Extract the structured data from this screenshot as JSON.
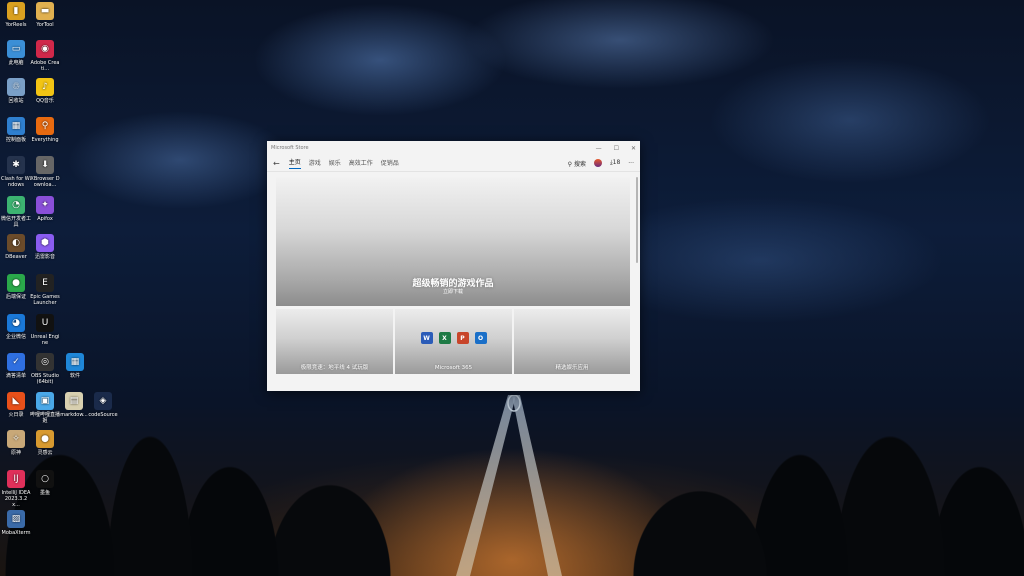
{
  "desktop": {
    "icons": [
      {
        "label": "YorReels",
        "color": "#d9a020",
        "glyph": "▮"
      },
      {
        "label": "YorTool",
        "color": "#e0b050",
        "glyph": "▬"
      },
      {
        "label": "此电脑",
        "color": "#3b8fd6",
        "glyph": "▭"
      },
      {
        "label": "Adobe Creati...",
        "color": "#d0284a",
        "glyph": "◉"
      },
      {
        "label": "回收站",
        "color": "#7aa0c8",
        "glyph": "♲"
      },
      {
        "label": "QQ音乐",
        "color": "#f2c414",
        "glyph": "♪"
      },
      {
        "label": "控制面板",
        "color": "#2f7fcf",
        "glyph": "▦"
      },
      {
        "label": "Everything",
        "color": "#e86a10",
        "glyph": "⚲"
      },
      {
        "label": "Clash for Windows",
        "color": "#25334d",
        "glyph": "✱"
      },
      {
        "label": "XBrowser Downloa...",
        "color": "#666666",
        "glyph": "⬇"
      },
      {
        "label": "微信开发者工具",
        "color": "#3cb371",
        "glyph": "◔"
      },
      {
        "label": "Apifox",
        "color": "#8a4fd8",
        "glyph": "✦"
      },
      {
        "label": "DBeaver",
        "color": "#6b4b2a",
        "glyph": "◐"
      },
      {
        "label": "迅雷影音",
        "color": "#8a5cf0",
        "glyph": "⬢"
      },
      {
        "label": "后端保证",
        "color": "#2aa84a",
        "glyph": "●"
      },
      {
        "label": "Epic Games Launcher",
        "color": "#222222",
        "glyph": "E"
      },
      {
        "label": "企业微信",
        "color": "#1a78d8",
        "glyph": "◕"
      },
      {
        "label": "Unreal Engine",
        "color": "#111111",
        "glyph": "U"
      },
      {
        "label": "滴答清单",
        "color": "#2f6fe0",
        "glyph": "✓"
      },
      {
        "label": "OBS Studio (64bit)",
        "color": "#333333",
        "glyph": "◎"
      },
      {
        "label": "软件",
        "color": "#1f87d8",
        "glyph": "▦"
      },
      {
        "label": "火日录",
        "color": "#e8501a",
        "glyph": "◣"
      },
      {
        "label": "哔哩哔哩直播姬",
        "color": "#4aa8e8",
        "glyph": "▣"
      },
      {
        "label": "markdow...",
        "color": "#d8d0b0",
        "glyph": "▤"
      },
      {
        "label": "codeSource",
        "color": "#1a2a4a",
        "glyph": "◈"
      },
      {
        "label": "原神",
        "color": "#c8a878",
        "glyph": "✧"
      },
      {
        "label": "灵感云",
        "color": "#d89a30",
        "glyph": "●"
      },
      {
        "label": "IntelliJ IDEA 2023.3.2 x...",
        "color": "#e0305a",
        "glyph": "IJ"
      },
      {
        "label": "墨鱼",
        "color": "#111111",
        "glyph": "○"
      },
      {
        "label": "MobaXterm",
        "color": "#3a6aa8",
        "glyph": "▨"
      }
    ]
  },
  "window": {
    "title": "Microsoft Store",
    "controls": {
      "minimize": "—",
      "maximize": "☐",
      "close": "✕"
    },
    "nav": {
      "back": "←",
      "tabs": [
        "主页",
        "游戏",
        "娱乐",
        "高效工作",
        "促销品"
      ],
      "search_label": "搜索",
      "downloads_count": "18",
      "more": "···"
    },
    "hero": {
      "title": "超级畅销的游戏作品",
      "subtitle": "立即下载"
    },
    "tiles": [
      {
        "label": "极限竞速：地平线 4 试玩版"
      },
      {
        "label": "Microsoft 365"
      },
      {
        "label": "精选娱乐应用"
      }
    ],
    "office_icons": [
      {
        "name": "word-icon",
        "letter": "W",
        "color": "#2b5cb8"
      },
      {
        "name": "excel-icon",
        "letter": "X",
        "color": "#1e7a45"
      },
      {
        "name": "powerpoint-icon",
        "letter": "P",
        "color": "#c8452a"
      },
      {
        "name": "outlook-icon",
        "letter": "O",
        "color": "#1a6fc8"
      }
    ]
  }
}
